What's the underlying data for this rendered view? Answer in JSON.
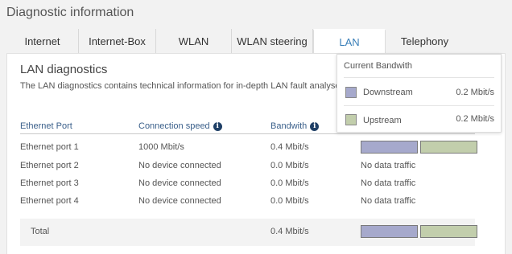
{
  "page": {
    "title": "Diagnostic information"
  },
  "tabs": [
    {
      "label": "Internet"
    },
    {
      "label": "Internet-Box"
    },
    {
      "label": "WLAN"
    },
    {
      "label": "WLAN steering"
    },
    {
      "label": "LAN",
      "active": true
    },
    {
      "label": "Telephony"
    }
  ],
  "section": {
    "title": "LAN diagnostics",
    "description": "The LAN diagnostics contains technical information for in-depth LAN fault analyse"
  },
  "table": {
    "headers": {
      "port": "Ethernet Port",
      "speed": "Connection speed",
      "bandwidth": "Bandwith"
    },
    "rows": [
      {
        "port": "Ethernet port 1",
        "speed": "1000 Mbit/s",
        "bandwidth": "0.4 Mbit/s",
        "traffic": ""
      },
      {
        "port": "Ethernet port 2",
        "speed": "No device connected",
        "bandwidth": "0.0 Mbit/s",
        "traffic": "No data traffic"
      },
      {
        "port": "Ethernet port 3",
        "speed": "No device connected",
        "bandwidth": "0.0 Mbit/s",
        "traffic": "No data traffic"
      },
      {
        "port": "Ethernet port 4",
        "speed": "No device connected",
        "bandwidth": "0.0 Mbit/s",
        "traffic": "No data traffic"
      }
    ],
    "total": {
      "label": "Total",
      "bandwidth": "0.4 Mbit/s"
    }
  },
  "popup": {
    "title": "Current Bandwith",
    "downstream": {
      "label": "Downstream",
      "value": "0.2 Mbit/s"
    },
    "upstream": {
      "label": "Upstream",
      "value": "0.2 Mbit/s"
    }
  },
  "icons": {
    "info": "info-icon"
  },
  "colors": {
    "downstream": "#a6a9cc",
    "upstream": "#c2ceac",
    "active_tab": "#3a7fb8"
  }
}
